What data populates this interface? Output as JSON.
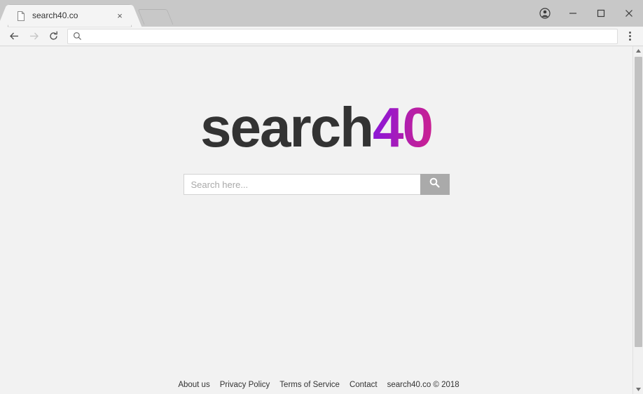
{
  "browser": {
    "tab": {
      "title": "search40.co",
      "favicon": "page-icon",
      "close": "×"
    },
    "new_tab_label": "",
    "window_controls": {
      "profile": "profile-icon",
      "minimize": "–",
      "maximize": "□",
      "close": "×"
    },
    "toolbar": {
      "back": "←",
      "forward": "→",
      "reload": "↻",
      "omnibox_value": "",
      "omnibox_placeholder": "",
      "omnibox_icon": "search-icon",
      "menu": "three-dot-menu"
    }
  },
  "page": {
    "logo": {
      "word": "search",
      "number": "40",
      "word_color": "#333333",
      "gradient_start": "#8a17d8",
      "gradient_end": "#cc1f8f"
    },
    "search": {
      "value": "",
      "placeholder": "Search here...",
      "button_icon": "magnifier-icon",
      "button_color": "#aaaaaa"
    },
    "footer": {
      "links": [
        {
          "label": "About us"
        },
        {
          "label": "Privacy Policy"
        },
        {
          "label": "Terms of Service"
        },
        {
          "label": "Contact"
        }
      ],
      "copyright": "search40.co © 2018"
    },
    "background_color": "#f2f2f2"
  }
}
